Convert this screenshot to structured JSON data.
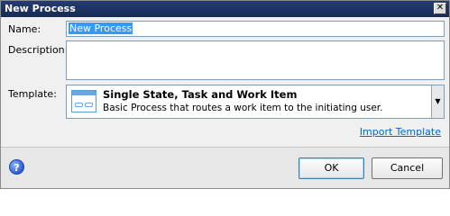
{
  "window": {
    "title": "New Process",
    "close_glyph": "✕"
  },
  "form": {
    "name_label": "Name:",
    "name_value": "New Process",
    "description_label": "Description:",
    "description_value": "",
    "template_label": "Template:"
  },
  "template": {
    "selected_name": "Single State, Task and Work Item",
    "selected_description": "Basic Process that routes a work item to the initiating user.",
    "dropdown_glyph": "▼"
  },
  "import_link": "Import Template",
  "footer": {
    "help_glyph": "?",
    "ok_label": "OK",
    "cancel_label": "Cancel"
  }
}
